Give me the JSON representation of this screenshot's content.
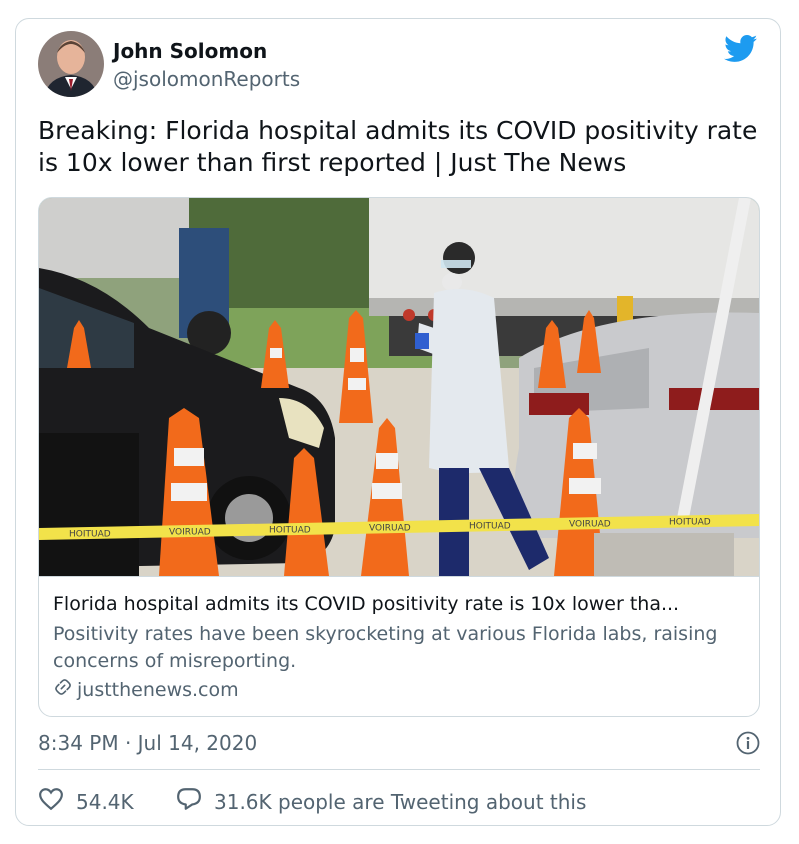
{
  "author": {
    "name": "John Solomon",
    "handle": "@jsolomonReports"
  },
  "tweet": {
    "text": "Breaking: Florida hospital admits its COVID positivity rate is 10x lower than first reported | Just The News"
  },
  "link_card": {
    "title": "Florida hospital admits its COVID positivity rate is 10x lower tha...",
    "description": "Positivity rates have been skyrocketing at various Florida labs, raising concerns of misreporting.",
    "domain": "justthenews.com",
    "tape_text": [
      "HOITUAD",
      "VOIRUAD",
      "HOITUAD",
      "VOIRUAD",
      "HOITUAD",
      "VOIRUAD",
      "HOITUAD"
    ]
  },
  "meta": {
    "timestamp": "8:34 PM · Jul 14, 2020"
  },
  "actions": {
    "likes": "54.4K",
    "conversation": "31.6K people are Tweeting about this"
  },
  "colors": {
    "brand": "#1d9bf0",
    "secondary_text": "#536471",
    "border": "#cfd9de"
  },
  "icons": {
    "logo": "twitter-bird-icon",
    "info": "info-icon",
    "like": "heart-icon",
    "reply": "speech-bubble-icon",
    "link": "link-icon"
  }
}
